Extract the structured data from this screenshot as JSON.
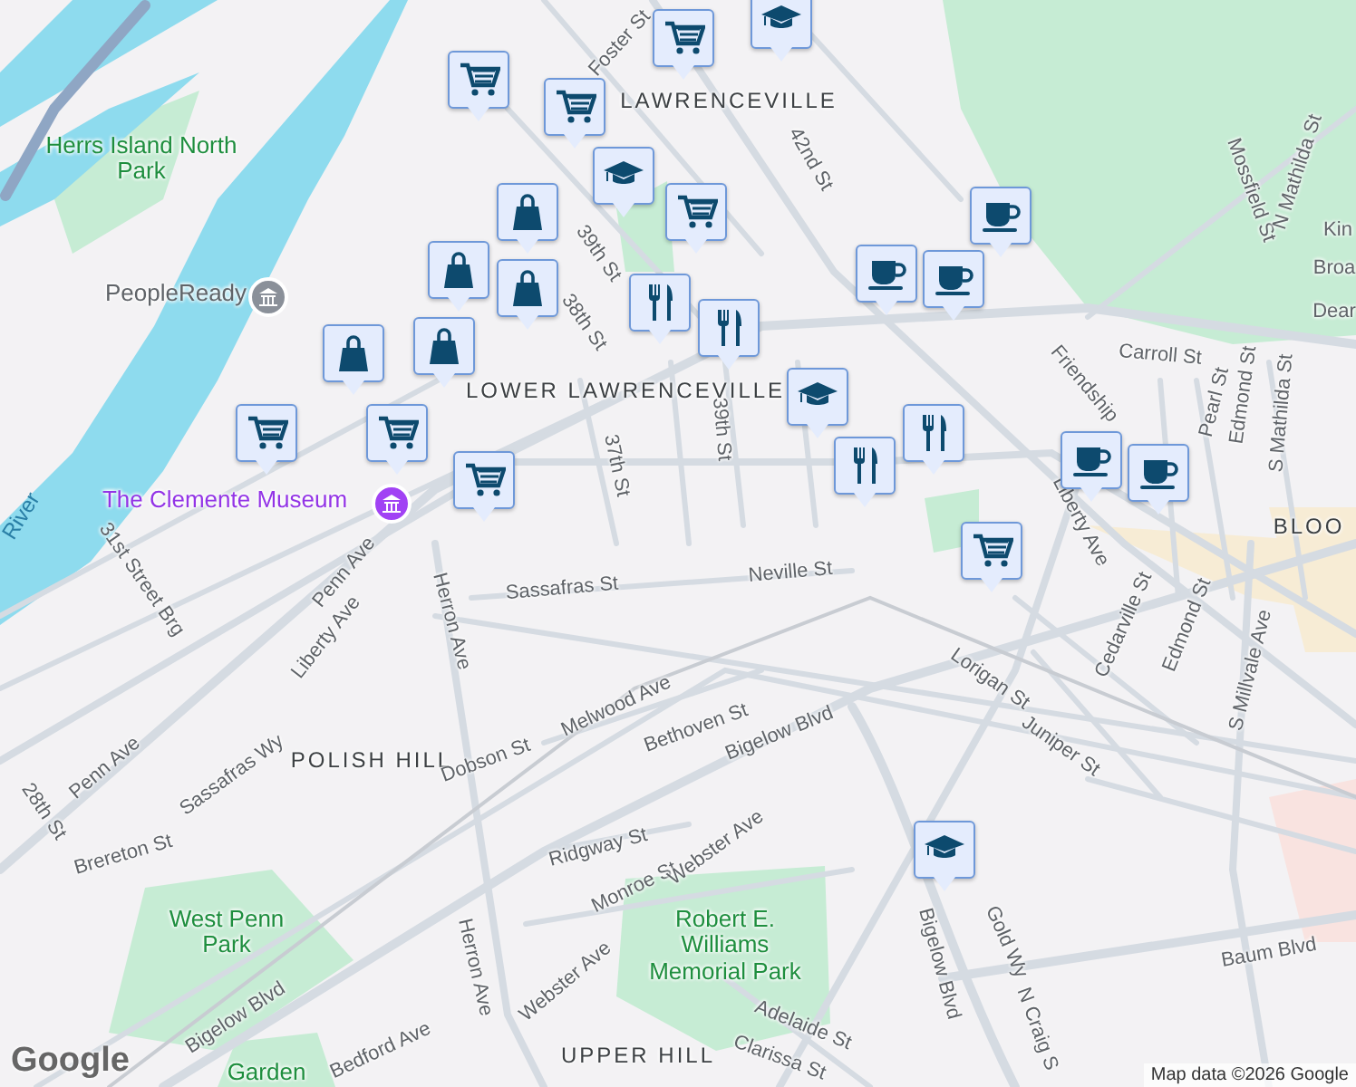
{
  "map": {
    "labels": [
      {
        "text": "Foster St",
        "kind": "street"
      },
      {
        "text": "LAWRENCEVILLE",
        "kind": "neighborhood"
      },
      {
        "text": "42nd St",
        "kind": "street"
      },
      {
        "text": "Herrs Island North Park",
        "kind": "park"
      },
      {
        "text": "PeopleReady",
        "kind": "poi"
      },
      {
        "text": "39th St",
        "kind": "street"
      },
      {
        "text": "38th St",
        "kind": "street"
      },
      {
        "text": "LOWER LAWRENCEVILLE",
        "kind": "neighborhood"
      },
      {
        "text": "37th St",
        "kind": "street"
      },
      {
        "text": "39th St",
        "kind": "street"
      },
      {
        "text": "The Clemente Museum",
        "kind": "museum"
      },
      {
        "text": "River",
        "kind": "water"
      },
      {
        "text": "Mossfield St",
        "kind": "street"
      },
      {
        "text": "N Mathilda St",
        "kind": "street"
      },
      {
        "text": "Kin",
        "kind": "street"
      },
      {
        "text": "Broa",
        "kind": "street"
      },
      {
        "text": "Dear",
        "kind": "street"
      },
      {
        "text": "Carroll St",
        "kind": "street"
      },
      {
        "text": "Friendship",
        "kind": "street"
      },
      {
        "text": "Pearl St",
        "kind": "street"
      },
      {
        "text": "Edmond St",
        "kind": "street"
      },
      {
        "text": "S Mathilda St",
        "kind": "street"
      },
      {
        "text": "Liberty Ave",
        "kind": "street"
      },
      {
        "text": "BLOO",
        "kind": "neighborhood"
      },
      {
        "text": "31st Street Brg",
        "kind": "street"
      },
      {
        "text": "Penn Ave",
        "kind": "street"
      },
      {
        "text": "Liberty Ave",
        "kind": "street"
      },
      {
        "text": "Herron Ave",
        "kind": "street"
      },
      {
        "text": "Sassafras St",
        "kind": "street"
      },
      {
        "text": "Neville St",
        "kind": "street"
      },
      {
        "text": "Lorigan St",
        "kind": "street"
      },
      {
        "text": "Cedarville St",
        "kind": "street"
      },
      {
        "text": "Edmond St",
        "kind": "street"
      },
      {
        "text": "Juniper St",
        "kind": "street"
      },
      {
        "text": "S Millvale Ave",
        "kind": "street"
      },
      {
        "text": "Sassafras Wy",
        "kind": "street"
      },
      {
        "text": "Penn Ave",
        "kind": "street"
      },
      {
        "text": "POLISH HILL",
        "kind": "neighborhood"
      },
      {
        "text": "Melwood Ave",
        "kind": "street"
      },
      {
        "text": "Dobson St",
        "kind": "street"
      },
      {
        "text": "Bethoven St",
        "kind": "street"
      },
      {
        "text": "Bigelow Blvd",
        "kind": "street"
      },
      {
        "text": "28th St",
        "kind": "street"
      },
      {
        "text": "Brereton St",
        "kind": "street"
      },
      {
        "text": "Ridgway St",
        "kind": "street"
      },
      {
        "text": "Monroe St",
        "kind": "street"
      },
      {
        "text": "Webster Ave",
        "kind": "street"
      },
      {
        "text": "West Penn Park",
        "kind": "park"
      },
      {
        "text": "Robert E. Williams Memorial Park",
        "kind": "park"
      },
      {
        "text": "Herron Ave",
        "kind": "street"
      },
      {
        "text": "Webster Ave",
        "kind": "street"
      },
      {
        "text": "Bigelow Blvd",
        "kind": "street"
      },
      {
        "text": "Gold Wy",
        "kind": "street"
      },
      {
        "text": "Baum Blvd",
        "kind": "street"
      },
      {
        "text": "UPPER HILL",
        "kind": "neighborhood"
      },
      {
        "text": "Adelaide St",
        "kind": "street"
      },
      {
        "text": "Clarissa St",
        "kind": "street"
      },
      {
        "text": "Bigelow Blvd",
        "kind": "street"
      },
      {
        "text": "Bedford Ave",
        "kind": "street"
      },
      {
        "text": "Garden",
        "kind": "park"
      },
      {
        "text": "N Craig S",
        "kind": "street"
      }
    ],
    "pins": [
      {
        "kind": "cart"
      },
      {
        "kind": "cap"
      },
      {
        "kind": "cart"
      },
      {
        "kind": "cart"
      },
      {
        "kind": "cap"
      },
      {
        "kind": "cart"
      },
      {
        "kind": "bag"
      },
      {
        "kind": "bag"
      },
      {
        "kind": "fork"
      },
      {
        "kind": "fork"
      },
      {
        "kind": "bag"
      },
      {
        "kind": "bag"
      },
      {
        "kind": "bag"
      },
      {
        "kind": "cart"
      },
      {
        "kind": "cart"
      },
      {
        "kind": "cart"
      },
      {
        "kind": "cup"
      },
      {
        "kind": "cup"
      },
      {
        "kind": "cup"
      },
      {
        "kind": "cap"
      },
      {
        "kind": "fork"
      },
      {
        "kind": "fork"
      },
      {
        "kind": "cup"
      },
      {
        "kind": "cup"
      },
      {
        "kind": "cart"
      },
      {
        "kind": "cap"
      }
    ],
    "logo": "Google",
    "attribution": "Map data ©2026 Google"
  }
}
